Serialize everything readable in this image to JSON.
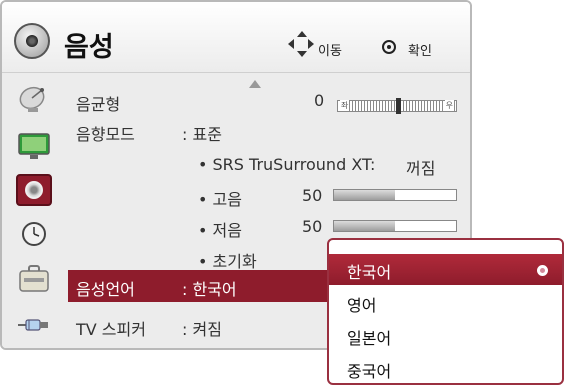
{
  "header": {
    "title": "음성",
    "hint_move": "이동",
    "hint_ok": "확인",
    "icon": "speaker-icon"
  },
  "sidebar": {
    "icons": [
      "satellite-dish-icon",
      "monitor-icon",
      "speaker-icon",
      "clock-icon",
      "lock-icon",
      "input-plug-icon"
    ],
    "active_index": 2
  },
  "menu": {
    "balance": {
      "label": "음균형",
      "value": "0",
      "left": "좌",
      "right": "우",
      "level": 0.5
    },
    "sound_mode": {
      "label": "음향모드",
      "value": ": 표준"
    },
    "srs": {
      "label": "• SRS TruSurround XT:",
      "value": "꺼짐"
    },
    "treble": {
      "label": "• 고음",
      "value": "50",
      "level": 0.5
    },
    "bass": {
      "label": "• 저음",
      "value": "50",
      "level": 0.5
    },
    "reset": {
      "label": "• 초기화"
    },
    "language": {
      "label": "음성언어",
      "value": ": 한국어"
    },
    "tv_speaker": {
      "label": "TV 스피커",
      "value": ": 켜짐"
    }
  },
  "dropdown": {
    "options": [
      "한국어",
      "영어",
      "일본어",
      "중국어"
    ],
    "selected_index": 0
  },
  "colors": {
    "accent": "#8e1c2c",
    "panel_bg": "#ececec",
    "text": "#333333"
  }
}
